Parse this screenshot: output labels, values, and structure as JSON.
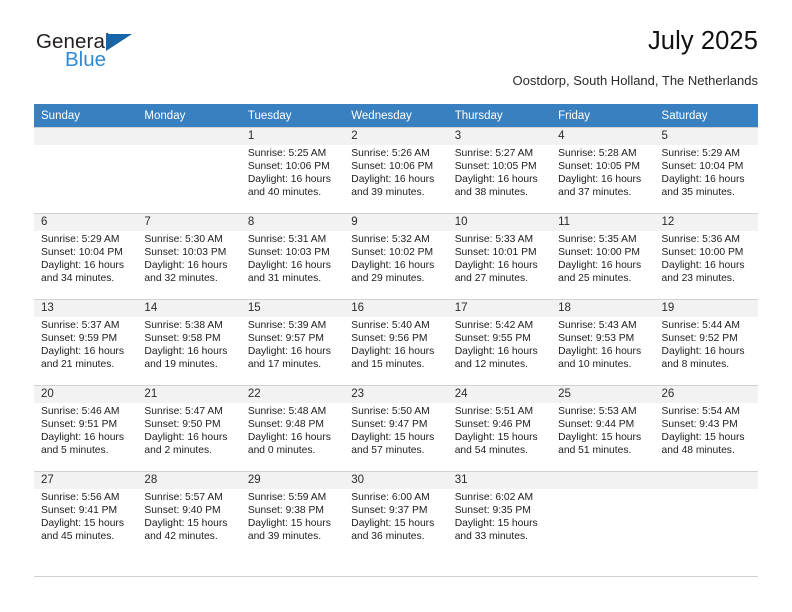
{
  "brand": {
    "name_dark": "General",
    "name_light": "Blue",
    "triangle_color": "#1565a8",
    "light_color": "#2c8ad6"
  },
  "header": {
    "title": "July 2025",
    "subtitle": "Oostdorp, South Holland, The Netherlands"
  },
  "theme": {
    "header_bg": "#3880c0",
    "daynum_bg": "#f2f2f2",
    "grid_line": "#d2d2d2"
  },
  "weekday_headers": [
    "Sunday",
    "Monday",
    "Tuesday",
    "Wednesday",
    "Thursday",
    "Friday",
    "Saturday"
  ],
  "labels": {
    "sunrise": "Sunrise:",
    "sunset": "Sunset:",
    "daylight": "Daylight:"
  },
  "weeks": [
    [
      {
        "day": "",
        "sunrise": "",
        "sunset": "",
        "daylight": ""
      },
      {
        "day": "",
        "sunrise": "",
        "sunset": "",
        "daylight": ""
      },
      {
        "day": "1",
        "sunrise": "Sunrise: 5:25 AM",
        "sunset": "Sunset: 10:06 PM",
        "daylight": "Daylight: 16 hours and 40 minutes."
      },
      {
        "day": "2",
        "sunrise": "Sunrise: 5:26 AM",
        "sunset": "Sunset: 10:06 PM",
        "daylight": "Daylight: 16 hours and 39 minutes."
      },
      {
        "day": "3",
        "sunrise": "Sunrise: 5:27 AM",
        "sunset": "Sunset: 10:05 PM",
        "daylight": "Daylight: 16 hours and 38 minutes."
      },
      {
        "day": "4",
        "sunrise": "Sunrise: 5:28 AM",
        "sunset": "Sunset: 10:05 PM",
        "daylight": "Daylight: 16 hours and 37 minutes."
      },
      {
        "day": "5",
        "sunrise": "Sunrise: 5:29 AM",
        "sunset": "Sunset: 10:04 PM",
        "daylight": "Daylight: 16 hours and 35 minutes."
      }
    ],
    [
      {
        "day": "6",
        "sunrise": "Sunrise: 5:29 AM",
        "sunset": "Sunset: 10:04 PM",
        "daylight": "Daylight: 16 hours and 34 minutes."
      },
      {
        "day": "7",
        "sunrise": "Sunrise: 5:30 AM",
        "sunset": "Sunset: 10:03 PM",
        "daylight": "Daylight: 16 hours and 32 minutes."
      },
      {
        "day": "8",
        "sunrise": "Sunrise: 5:31 AM",
        "sunset": "Sunset: 10:03 PM",
        "daylight": "Daylight: 16 hours and 31 minutes."
      },
      {
        "day": "9",
        "sunrise": "Sunrise: 5:32 AM",
        "sunset": "Sunset: 10:02 PM",
        "daylight": "Daylight: 16 hours and 29 minutes."
      },
      {
        "day": "10",
        "sunrise": "Sunrise: 5:33 AM",
        "sunset": "Sunset: 10:01 PM",
        "daylight": "Daylight: 16 hours and 27 minutes."
      },
      {
        "day": "11",
        "sunrise": "Sunrise: 5:35 AM",
        "sunset": "Sunset: 10:00 PM",
        "daylight": "Daylight: 16 hours and 25 minutes."
      },
      {
        "day": "12",
        "sunrise": "Sunrise: 5:36 AM",
        "sunset": "Sunset: 10:00 PM",
        "daylight": "Daylight: 16 hours and 23 minutes."
      }
    ],
    [
      {
        "day": "13",
        "sunrise": "Sunrise: 5:37 AM",
        "sunset": "Sunset: 9:59 PM",
        "daylight": "Daylight: 16 hours and 21 minutes."
      },
      {
        "day": "14",
        "sunrise": "Sunrise: 5:38 AM",
        "sunset": "Sunset: 9:58 PM",
        "daylight": "Daylight: 16 hours and 19 minutes."
      },
      {
        "day": "15",
        "sunrise": "Sunrise: 5:39 AM",
        "sunset": "Sunset: 9:57 PM",
        "daylight": "Daylight: 16 hours and 17 minutes."
      },
      {
        "day": "16",
        "sunrise": "Sunrise: 5:40 AM",
        "sunset": "Sunset: 9:56 PM",
        "daylight": "Daylight: 16 hours and 15 minutes."
      },
      {
        "day": "17",
        "sunrise": "Sunrise: 5:42 AM",
        "sunset": "Sunset: 9:55 PM",
        "daylight": "Daylight: 16 hours and 12 minutes."
      },
      {
        "day": "18",
        "sunrise": "Sunrise: 5:43 AM",
        "sunset": "Sunset: 9:53 PM",
        "daylight": "Daylight: 16 hours and 10 minutes."
      },
      {
        "day": "19",
        "sunrise": "Sunrise: 5:44 AM",
        "sunset": "Sunset: 9:52 PM",
        "daylight": "Daylight: 16 hours and 8 minutes."
      }
    ],
    [
      {
        "day": "20",
        "sunrise": "Sunrise: 5:46 AM",
        "sunset": "Sunset: 9:51 PM",
        "daylight": "Daylight: 16 hours and 5 minutes."
      },
      {
        "day": "21",
        "sunrise": "Sunrise: 5:47 AM",
        "sunset": "Sunset: 9:50 PM",
        "daylight": "Daylight: 16 hours and 2 minutes."
      },
      {
        "day": "22",
        "sunrise": "Sunrise: 5:48 AM",
        "sunset": "Sunset: 9:48 PM",
        "daylight": "Daylight: 16 hours and 0 minutes."
      },
      {
        "day": "23",
        "sunrise": "Sunrise: 5:50 AM",
        "sunset": "Sunset: 9:47 PM",
        "daylight": "Daylight: 15 hours and 57 minutes."
      },
      {
        "day": "24",
        "sunrise": "Sunrise: 5:51 AM",
        "sunset": "Sunset: 9:46 PM",
        "daylight": "Daylight: 15 hours and 54 minutes."
      },
      {
        "day": "25",
        "sunrise": "Sunrise: 5:53 AM",
        "sunset": "Sunset: 9:44 PM",
        "daylight": "Daylight: 15 hours and 51 minutes."
      },
      {
        "day": "26",
        "sunrise": "Sunrise: 5:54 AM",
        "sunset": "Sunset: 9:43 PM",
        "daylight": "Daylight: 15 hours and 48 minutes."
      }
    ],
    [
      {
        "day": "27",
        "sunrise": "Sunrise: 5:56 AM",
        "sunset": "Sunset: 9:41 PM",
        "daylight": "Daylight: 15 hours and 45 minutes."
      },
      {
        "day": "28",
        "sunrise": "Sunrise: 5:57 AM",
        "sunset": "Sunset: 9:40 PM",
        "daylight": "Daylight: 15 hours and 42 minutes."
      },
      {
        "day": "29",
        "sunrise": "Sunrise: 5:59 AM",
        "sunset": "Sunset: 9:38 PM",
        "daylight": "Daylight: 15 hours and 39 minutes."
      },
      {
        "day": "30",
        "sunrise": "Sunrise: 6:00 AM",
        "sunset": "Sunset: 9:37 PM",
        "daylight": "Daylight: 15 hours and 36 minutes."
      },
      {
        "day": "31",
        "sunrise": "Sunrise: 6:02 AM",
        "sunset": "Sunset: 9:35 PM",
        "daylight": "Daylight: 15 hours and 33 minutes."
      },
      {
        "day": "",
        "sunrise": "",
        "sunset": "",
        "daylight": ""
      },
      {
        "day": "",
        "sunrise": "",
        "sunset": "",
        "daylight": ""
      }
    ]
  ]
}
